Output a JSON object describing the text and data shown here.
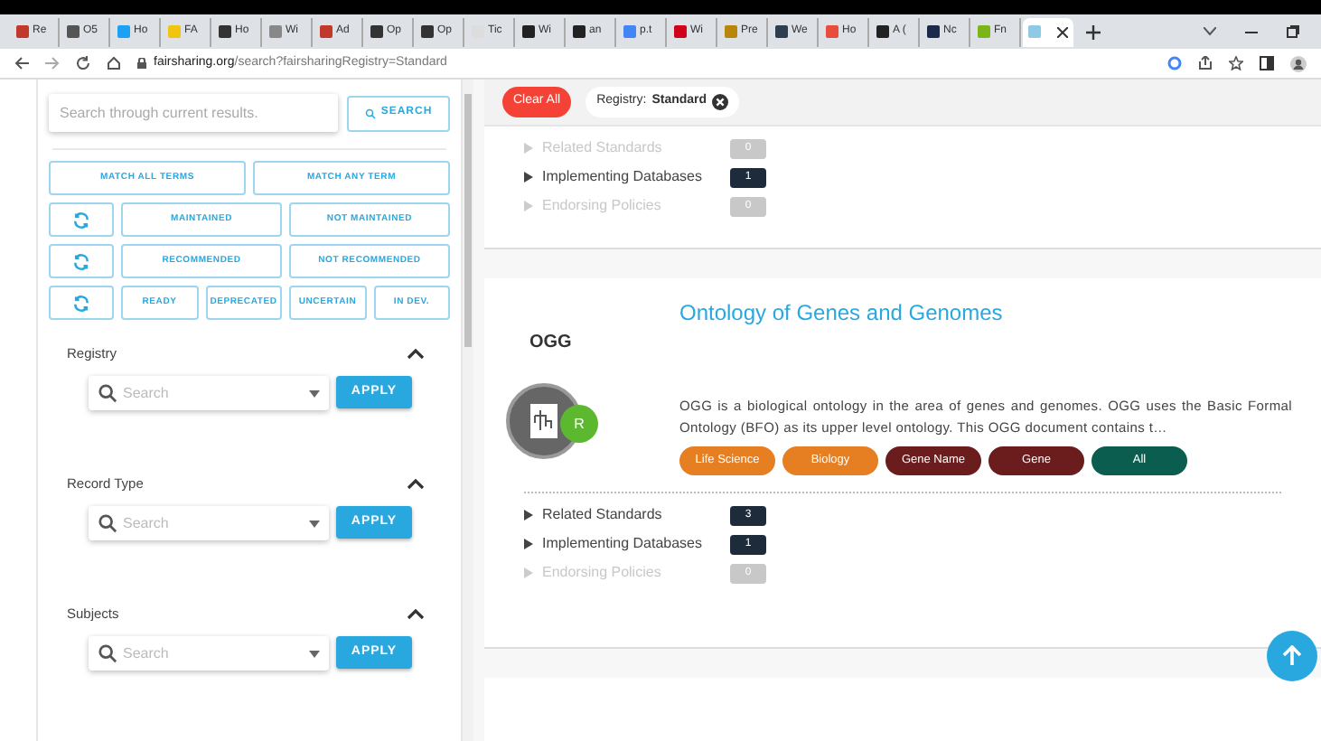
{
  "browser": {
    "tabs": [
      {
        "label": "Re",
        "color": "#c0392b",
        "selected": false
      },
      {
        "label": "O5",
        "color": "#555555",
        "selected": false
      },
      {
        "label": "Ho",
        "color": "#1da1f2",
        "selected": false
      },
      {
        "label": "FA",
        "color": "#f1c40f",
        "selected": false
      },
      {
        "label": "Ho",
        "color": "#333333",
        "selected": false
      },
      {
        "label": "Wi",
        "color": "#888888",
        "selected": false
      },
      {
        "label": "Ad",
        "color": "#c0392b",
        "selected": false
      },
      {
        "label": "Op",
        "color": "#333333",
        "selected": false
      },
      {
        "label": "Op",
        "color": "#333333",
        "selected": false
      },
      {
        "label": "Tic",
        "color": "#dddddd",
        "selected": false
      },
      {
        "label": "Wi",
        "color": "#222222",
        "selected": false
      },
      {
        "label": "an",
        "color": "#222222",
        "selected": false
      },
      {
        "label": "p.t",
        "color": "#4285f4",
        "selected": false
      },
      {
        "label": "Wi",
        "color": "#d0021b",
        "selected": false
      },
      {
        "label": "Pre",
        "color": "#b8860b",
        "selected": false
      },
      {
        "label": "We",
        "color": "#2c3e50",
        "selected": false
      },
      {
        "label": "Ho",
        "color": "#e74c3c",
        "selected": false
      },
      {
        "label": "A (",
        "color": "#222222",
        "selected": false
      },
      {
        "label": "Nc",
        "color": "#1a2a4a",
        "selected": false
      },
      {
        "label": "Fn",
        "color": "#7cb518",
        "selected": false
      },
      {
        "color": "#8ecae6",
        "selected": true
      }
    ],
    "url_host": "fairsharing.org",
    "url_path": "/search?fairsharingRegistry=Standard"
  },
  "sidebar": {
    "search": {
      "placeholder": "Search through current results.",
      "button": "SEARCH"
    },
    "filter_rows": [
      {
        "has_reset": false,
        "buttons": [
          "MATCH ALL TERMS",
          "MATCH ANY TERM"
        ]
      },
      {
        "has_reset": true,
        "buttons": [
          "MAINTAINED",
          "NOT MAINTAINED"
        ]
      },
      {
        "has_reset": true,
        "buttons": [
          "RECOMMENDED",
          "NOT RECOMMENDED"
        ]
      },
      {
        "has_reset": true,
        "buttons": [
          "READY",
          "DEPRECATED",
          "UNCERTAIN",
          "IN DEV."
        ]
      }
    ],
    "facets": [
      {
        "title": "Registry",
        "expanded": true,
        "placeholder": "Search",
        "button": "APPLY"
      },
      {
        "title": "Record Type",
        "expanded": true,
        "placeholder": "Search",
        "button": "APPLY"
      },
      {
        "title": "Subjects",
        "expanded": true,
        "placeholder": "Search",
        "button": "APPLY"
      }
    ]
  },
  "active_filters": {
    "clear": "Clear All",
    "chips": [
      {
        "label": "Registry:",
        "value": "Standard"
      }
    ]
  },
  "cards": [
    {
      "relations": [
        {
          "label": "Related Standards",
          "count": "0",
          "disabled": true
        },
        {
          "label": "Implementing Databases",
          "count": "1",
          "disabled": false
        },
        {
          "label": "Endorsing Policies",
          "count": "0",
          "disabled": true
        }
      ]
    },
    {
      "abbreviation": "OGG",
      "title": "Ontology of Genes and Genomes",
      "badge": "R",
      "description": "OGG is a biological ontology in the area of genes and genomes. OGG uses the Basic Formal Ontology (BFO) as its upper level ontology. This OGG document contains t…",
      "tags": [
        {
          "label": "Life Science",
          "color": "#e67e22"
        },
        {
          "label": "Biology",
          "color": "#e67e22"
        },
        {
          "label": "Gene Name",
          "color": "#6b1d1d"
        },
        {
          "label": "Gene",
          "color": "#6b1d1d"
        },
        {
          "label": "All",
          "color": "#0b5e4f"
        }
      ],
      "relations": [
        {
          "label": "Related Standards",
          "count": "3",
          "disabled": false
        },
        {
          "label": "Implementing Databases",
          "count": "1",
          "disabled": false
        },
        {
          "label": "Endorsing Policies",
          "count": "0",
          "disabled": true
        }
      ]
    }
  ]
}
